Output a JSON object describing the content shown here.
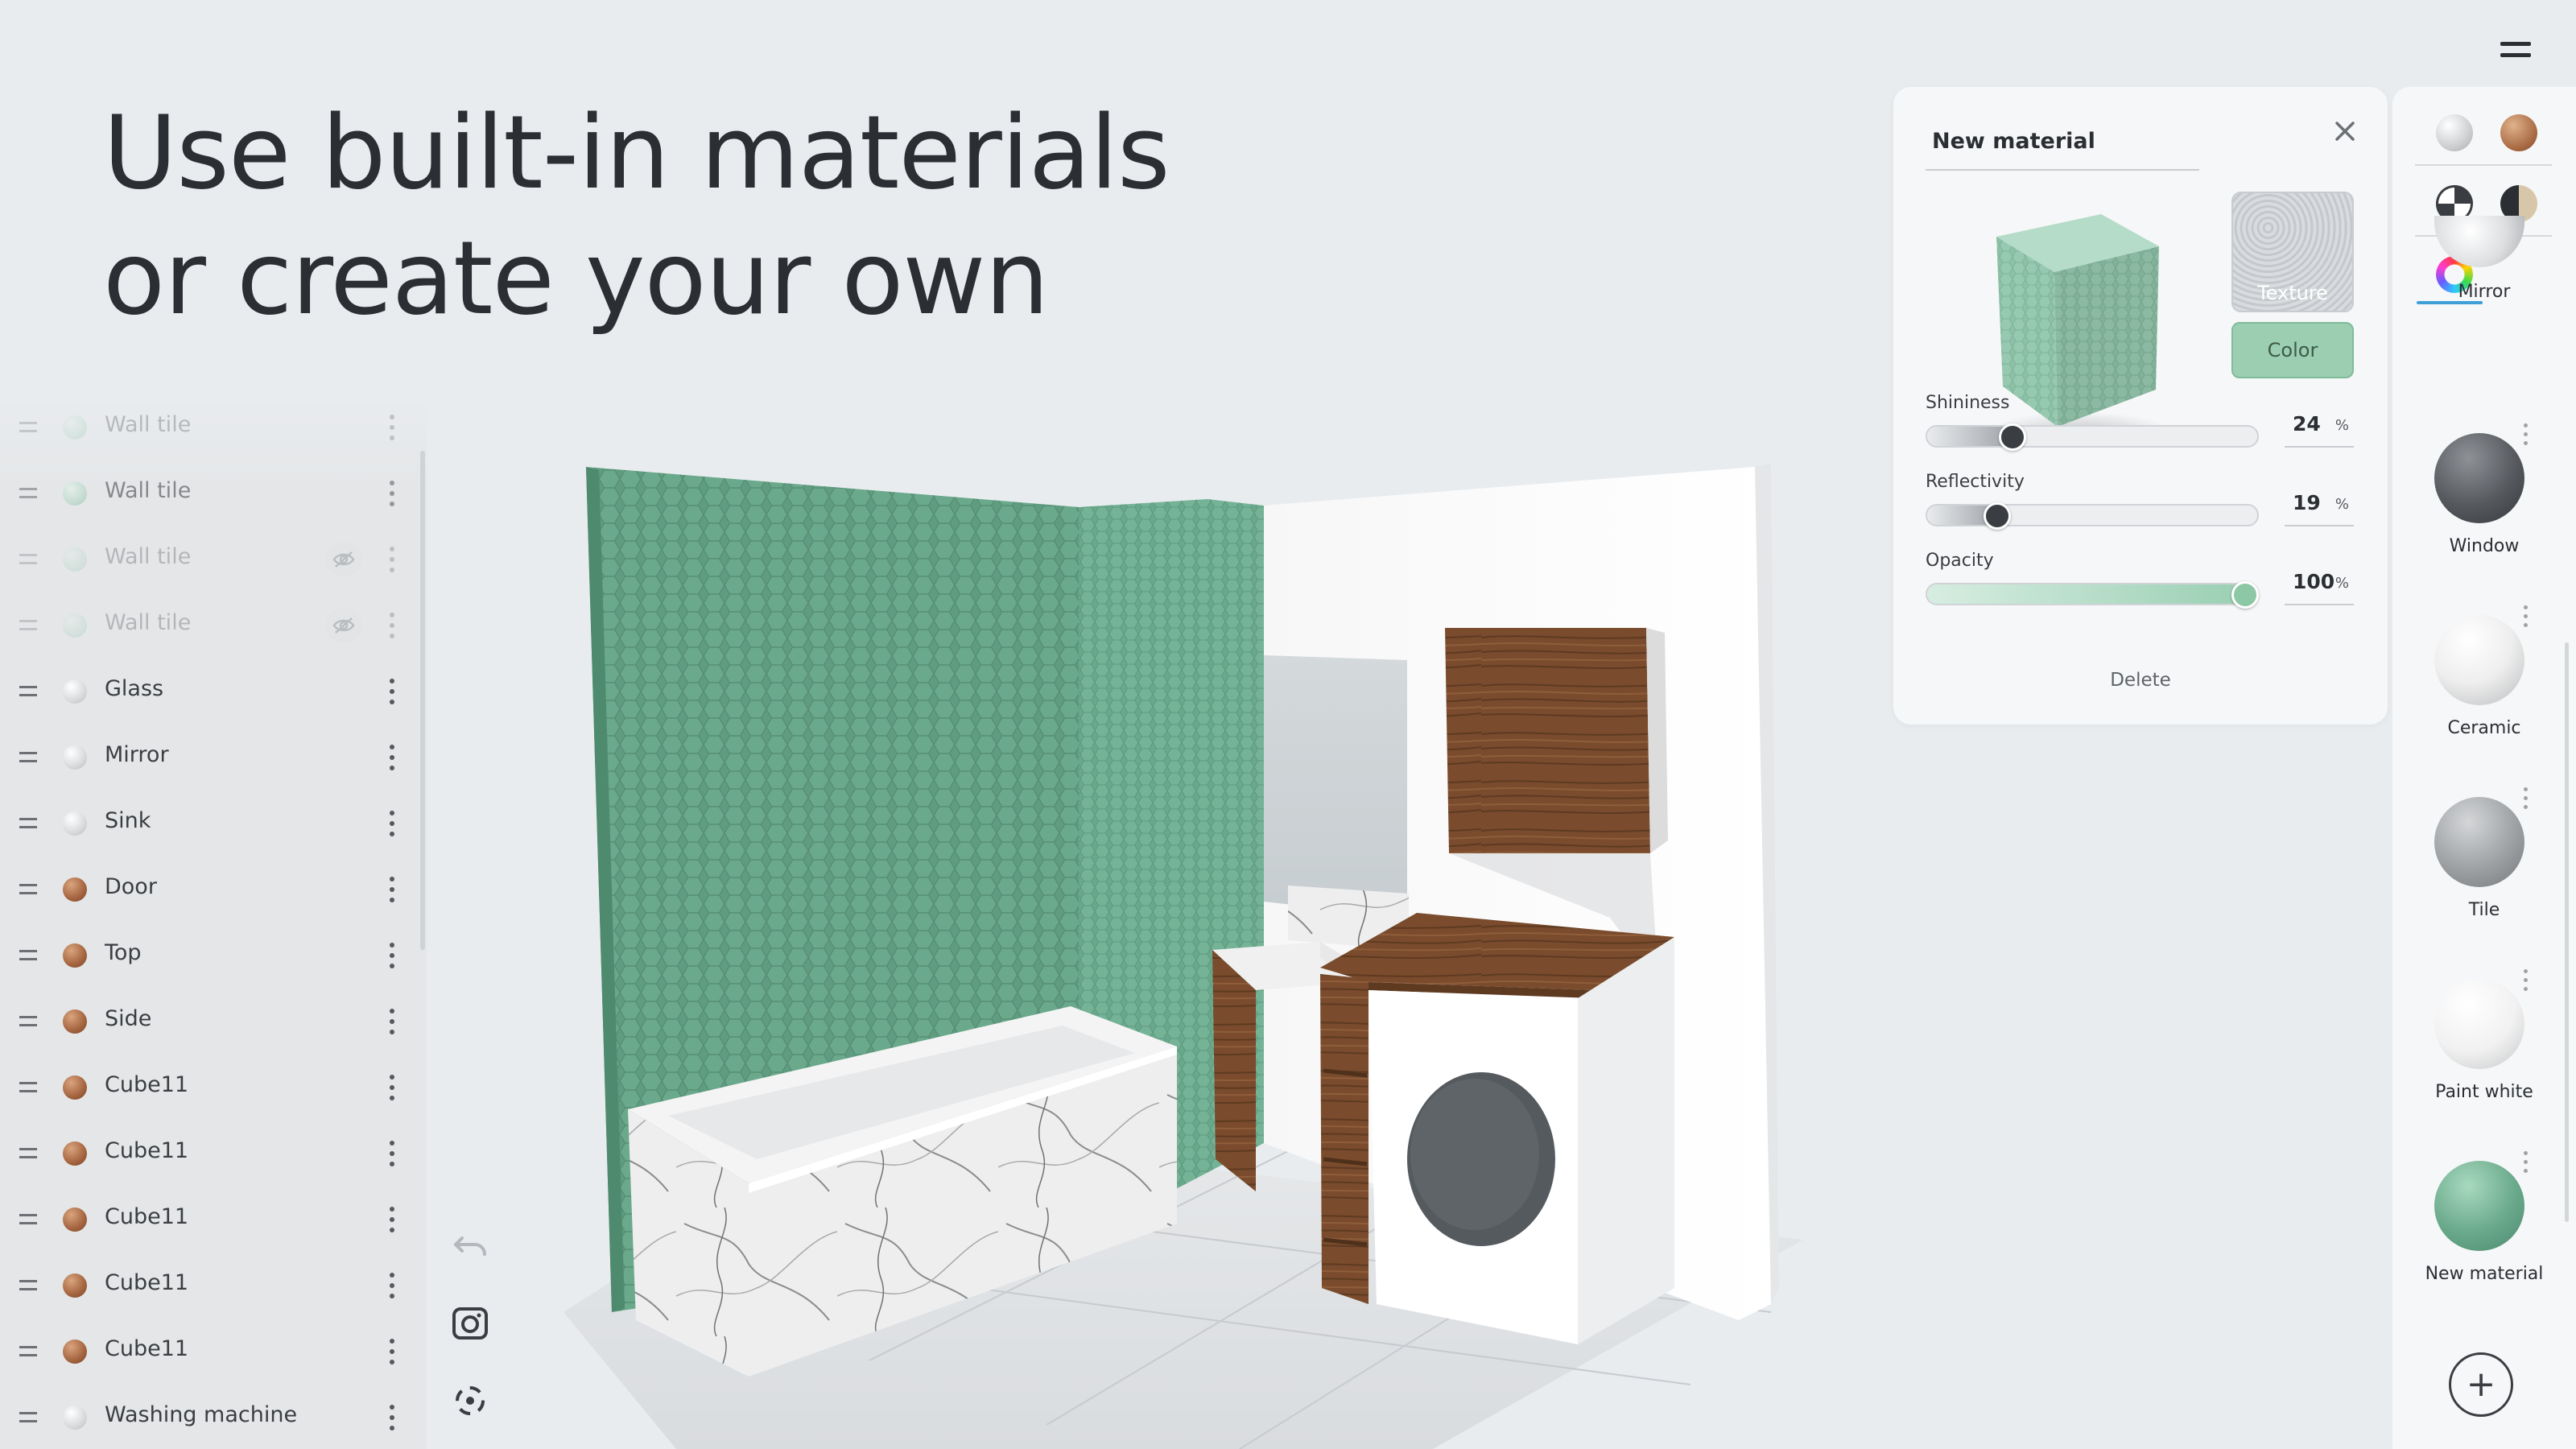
{
  "headline": {
    "line1": "Use built-in materials",
    "line2": "or create your own"
  },
  "layers": [
    {
      "name": "Wall tile",
      "swatch": "mint",
      "state": "faded"
    },
    {
      "name": "Wall tile",
      "swatch": "mint",
      "state": "faded2"
    },
    {
      "name": "Wall tile",
      "swatch": "mint",
      "state": "faded",
      "hidden_icon": "eye-off-icon"
    },
    {
      "name": "Wall tile",
      "swatch": "mint",
      "state": "faded",
      "hidden_icon": "eye-off-icon"
    },
    {
      "name": "Glass",
      "swatch": "white"
    },
    {
      "name": "Mirror",
      "swatch": "white"
    },
    {
      "name": "Sink",
      "swatch": "white"
    },
    {
      "name": "Door",
      "swatch": "wood"
    },
    {
      "name": "Top",
      "swatch": "wood"
    },
    {
      "name": "Side",
      "swatch": "wood"
    },
    {
      "name": "Cube11",
      "swatch": "wood"
    },
    {
      "name": "Cube11",
      "swatch": "wood"
    },
    {
      "name": "Cube11",
      "swatch": "wood"
    },
    {
      "name": "Cube11",
      "swatch": "wood"
    },
    {
      "name": "Cube11",
      "swatch": "wood"
    },
    {
      "name": "Washing machine",
      "swatch": "white"
    }
  ],
  "viewport_tools": [
    "undo-icon",
    "camera-icon",
    "recenter-icon"
  ],
  "editor": {
    "title": "New material",
    "texture_label": "Texture",
    "color_label": "Color",
    "sliders": [
      {
        "label": "Shininess",
        "value": "24",
        "unit": "%",
        "percent": 24,
        "style": "gray"
      },
      {
        "label": "Reflectivity",
        "value": "19",
        "unit": "%",
        "percent": 19,
        "style": "gray"
      },
      {
        "label": "Opacity",
        "value": "100",
        "unit": "%",
        "percent": 100,
        "style": "green"
      }
    ],
    "delete_label": "Delete"
  },
  "library": {
    "tabs": [
      "plain-sphere-icon",
      "wood-sphere-icon",
      "texture-sphere-icon",
      "half-sphere-icon",
      "color-wheel-icon"
    ],
    "items": [
      {
        "name": "Mirror",
        "material": "mirror"
      },
      {
        "name": "Window",
        "material": "window"
      },
      {
        "name": "Ceramic",
        "material": "ceramic"
      },
      {
        "name": "Tile",
        "material": "tile"
      },
      {
        "name": "Paint white",
        "material": "paint"
      },
      {
        "name": "New material",
        "material": "mint"
      }
    ],
    "add_label": "+"
  },
  "colors": {
    "background": "#e9ecef",
    "accent_green": "#9ccfb1",
    "tile_green": "#5f9c80",
    "wood": "#7a4b2c",
    "active_tab": "#3fa0d8"
  }
}
